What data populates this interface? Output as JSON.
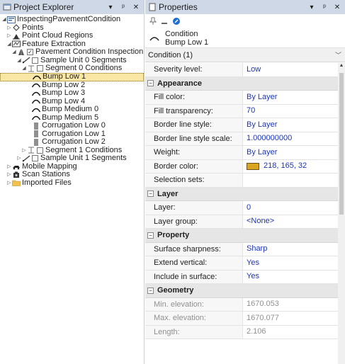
{
  "explorer": {
    "title": "Project Explorer",
    "header_buttons": [
      "▾",
      "ᵖ",
      "✕"
    ],
    "tree": [
      {
        "label": "InspectingPavementCondition",
        "indent": 0,
        "expander": "◢",
        "icon": "project-icon"
      },
      {
        "label": "Points",
        "indent": 1,
        "expander": "▷",
        "icon": "points-icon"
      },
      {
        "label": "Point Cloud Regions",
        "indent": 1,
        "expander": "▷",
        "icon": "point-cloud-regions-icon"
      },
      {
        "label": "Feature Extraction",
        "indent": 1,
        "expander": "◢",
        "icon": "feature-extraction-icon"
      },
      {
        "label": "Pavement Condition Inspection",
        "indent": 2,
        "expander": "◢",
        "icon": "inspection-icon",
        "checkbox": "checked"
      },
      {
        "label": "Sample Unit 0 Segments",
        "indent": 3,
        "expander": "◢",
        "icon": "segment-icon",
        "checkbox": "unchecked"
      },
      {
        "label": "Segment 0 Conditions",
        "indent": 4,
        "expander": "◢",
        "icon": "condition-group-icon",
        "checkbox": "unchecked"
      },
      {
        "label": "Bump Low 1",
        "indent": 5,
        "icon": "bump-icon",
        "selected": true
      },
      {
        "label": "Bump Low 2",
        "indent": 5,
        "icon": "bump-icon"
      },
      {
        "label": "Bump Low 3",
        "indent": 5,
        "icon": "bump-icon"
      },
      {
        "label": "Bump Low 4",
        "indent": 5,
        "icon": "bump-icon"
      },
      {
        "label": "Bump Medium 0",
        "indent": 5,
        "icon": "bump-icon"
      },
      {
        "label": "Bump Medium 5",
        "indent": 5,
        "icon": "bump-icon"
      },
      {
        "label": "Corrugation Low 0",
        "indent": 5,
        "icon": "corrugation-icon"
      },
      {
        "label": "Corrugation Low 1",
        "indent": 5,
        "icon": "corrugation-icon"
      },
      {
        "label": "Corrugation Low 2",
        "indent": 5,
        "icon": "corrugation-icon"
      },
      {
        "label": "Segment 1 Conditions",
        "indent": 4,
        "expander": "▷",
        "icon": "condition-group-icon",
        "checkbox": "unchecked"
      },
      {
        "label": "Sample Unit 1 Segments",
        "indent": 3,
        "expander": "▷",
        "icon": "segment-icon",
        "checkbox": "unchecked"
      },
      {
        "label": "Mobile Mapping",
        "indent": 1,
        "expander": "▷",
        "icon": "mobile-mapping-icon"
      },
      {
        "label": "Scan Stations",
        "indent": 1,
        "expander": "▷",
        "icon": "scan-stations-icon"
      },
      {
        "label": "Imported Files",
        "indent": 1,
        "expander": "▷",
        "icon": "folder-icon"
      }
    ]
  },
  "properties": {
    "title": "Properties",
    "header_buttons": [
      "▾",
      "ᵖ",
      "✕"
    ],
    "object_type": "Condition",
    "object_name": "Bump Low 1",
    "selection_dropdown": "Condition (1)",
    "rows": [
      {
        "kind": "prop",
        "name": "Severity level:",
        "value": "Low"
      },
      {
        "kind": "cat",
        "name": "Appearance"
      },
      {
        "kind": "prop",
        "name": "Fill color:",
        "value": "By Layer"
      },
      {
        "kind": "prop",
        "name": "Fill transparency:",
        "value": "70"
      },
      {
        "kind": "prop",
        "name": "Border line style:",
        "value": "By Layer"
      },
      {
        "kind": "prop",
        "name": "Border line style scale:",
        "value": "1.000000000"
      },
      {
        "kind": "prop",
        "name": "Weight:",
        "value": "By Layer"
      },
      {
        "kind": "prop",
        "name": "Border color:",
        "value": "218, 165, 32",
        "swatch": "#daa520"
      },
      {
        "kind": "prop",
        "name": "Selection sets:",
        "value": ""
      },
      {
        "kind": "cat",
        "name": "Layer"
      },
      {
        "kind": "prop",
        "name": "Layer:",
        "value": "0"
      },
      {
        "kind": "prop",
        "name": "Layer group:",
        "value": "<None>"
      },
      {
        "kind": "cat",
        "name": "Property"
      },
      {
        "kind": "prop",
        "name": "Surface sharpness:",
        "value": "Sharp"
      },
      {
        "kind": "prop",
        "name": "Extend vertical:",
        "value": "Yes"
      },
      {
        "kind": "prop",
        "name": "Include in surface:",
        "value": "Yes"
      },
      {
        "kind": "cat",
        "name": "Geometry"
      },
      {
        "kind": "prop",
        "name": "Min. elevation:",
        "value": "1670.053",
        "disabled": true
      },
      {
        "kind": "prop",
        "name": "Max. elevation:",
        "value": "1670.077",
        "disabled": true
      },
      {
        "kind": "prop",
        "name": "Length:",
        "value": "2.106",
        "disabled": true
      }
    ]
  },
  "colors": {
    "header_bg": "#cfd8e6",
    "selection_bg": "#fbe7a5",
    "value_text": "#1a34b8",
    "border_color_swatch": "#daa520"
  }
}
